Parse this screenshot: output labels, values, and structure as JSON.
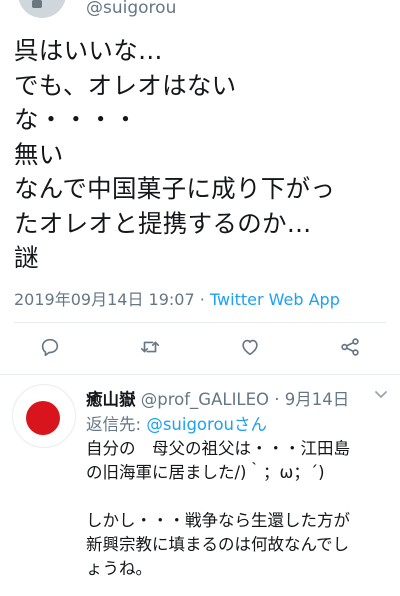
{
  "top": {
    "handle": "@suigorou"
  },
  "tweet": {
    "lines": [
      "呉はいいな…",
      "でも、オレオはない",
      "な・・・・",
      "無い",
      "なんで中国菓子に成り下がっ",
      "たオレオと提携するのか…",
      "謎"
    ],
    "timestamp": "2019年09月14日 19:07",
    "separator": "·",
    "source": "Twitter Web App"
  },
  "actions": {
    "reply": "reply-icon",
    "retweet": "retweet-icon",
    "like": "like-icon",
    "share": "share-icon"
  },
  "reply": {
    "name": "癒山嶽",
    "handle": "@prof_GALILEO",
    "dot": "·",
    "date": "9月14日",
    "reply_to_label": "返信先:",
    "reply_to_mention": "@suigorouさん",
    "lines": [
      "自分の　母父の祖父は・・・江田島",
      "の旧海軍に居ました/)｀；ω；´)",
      "",
      "しかし・・・戦争なら生還した方が",
      "新興宗教に填まるのは何故なんでし",
      "ょうね。"
    ]
  },
  "colors": {
    "text": "#14171a",
    "secondary": "#657786",
    "accent": "#1da1f2",
    "divider": "#e6ecf0",
    "flag_red": "#d8141c"
  }
}
